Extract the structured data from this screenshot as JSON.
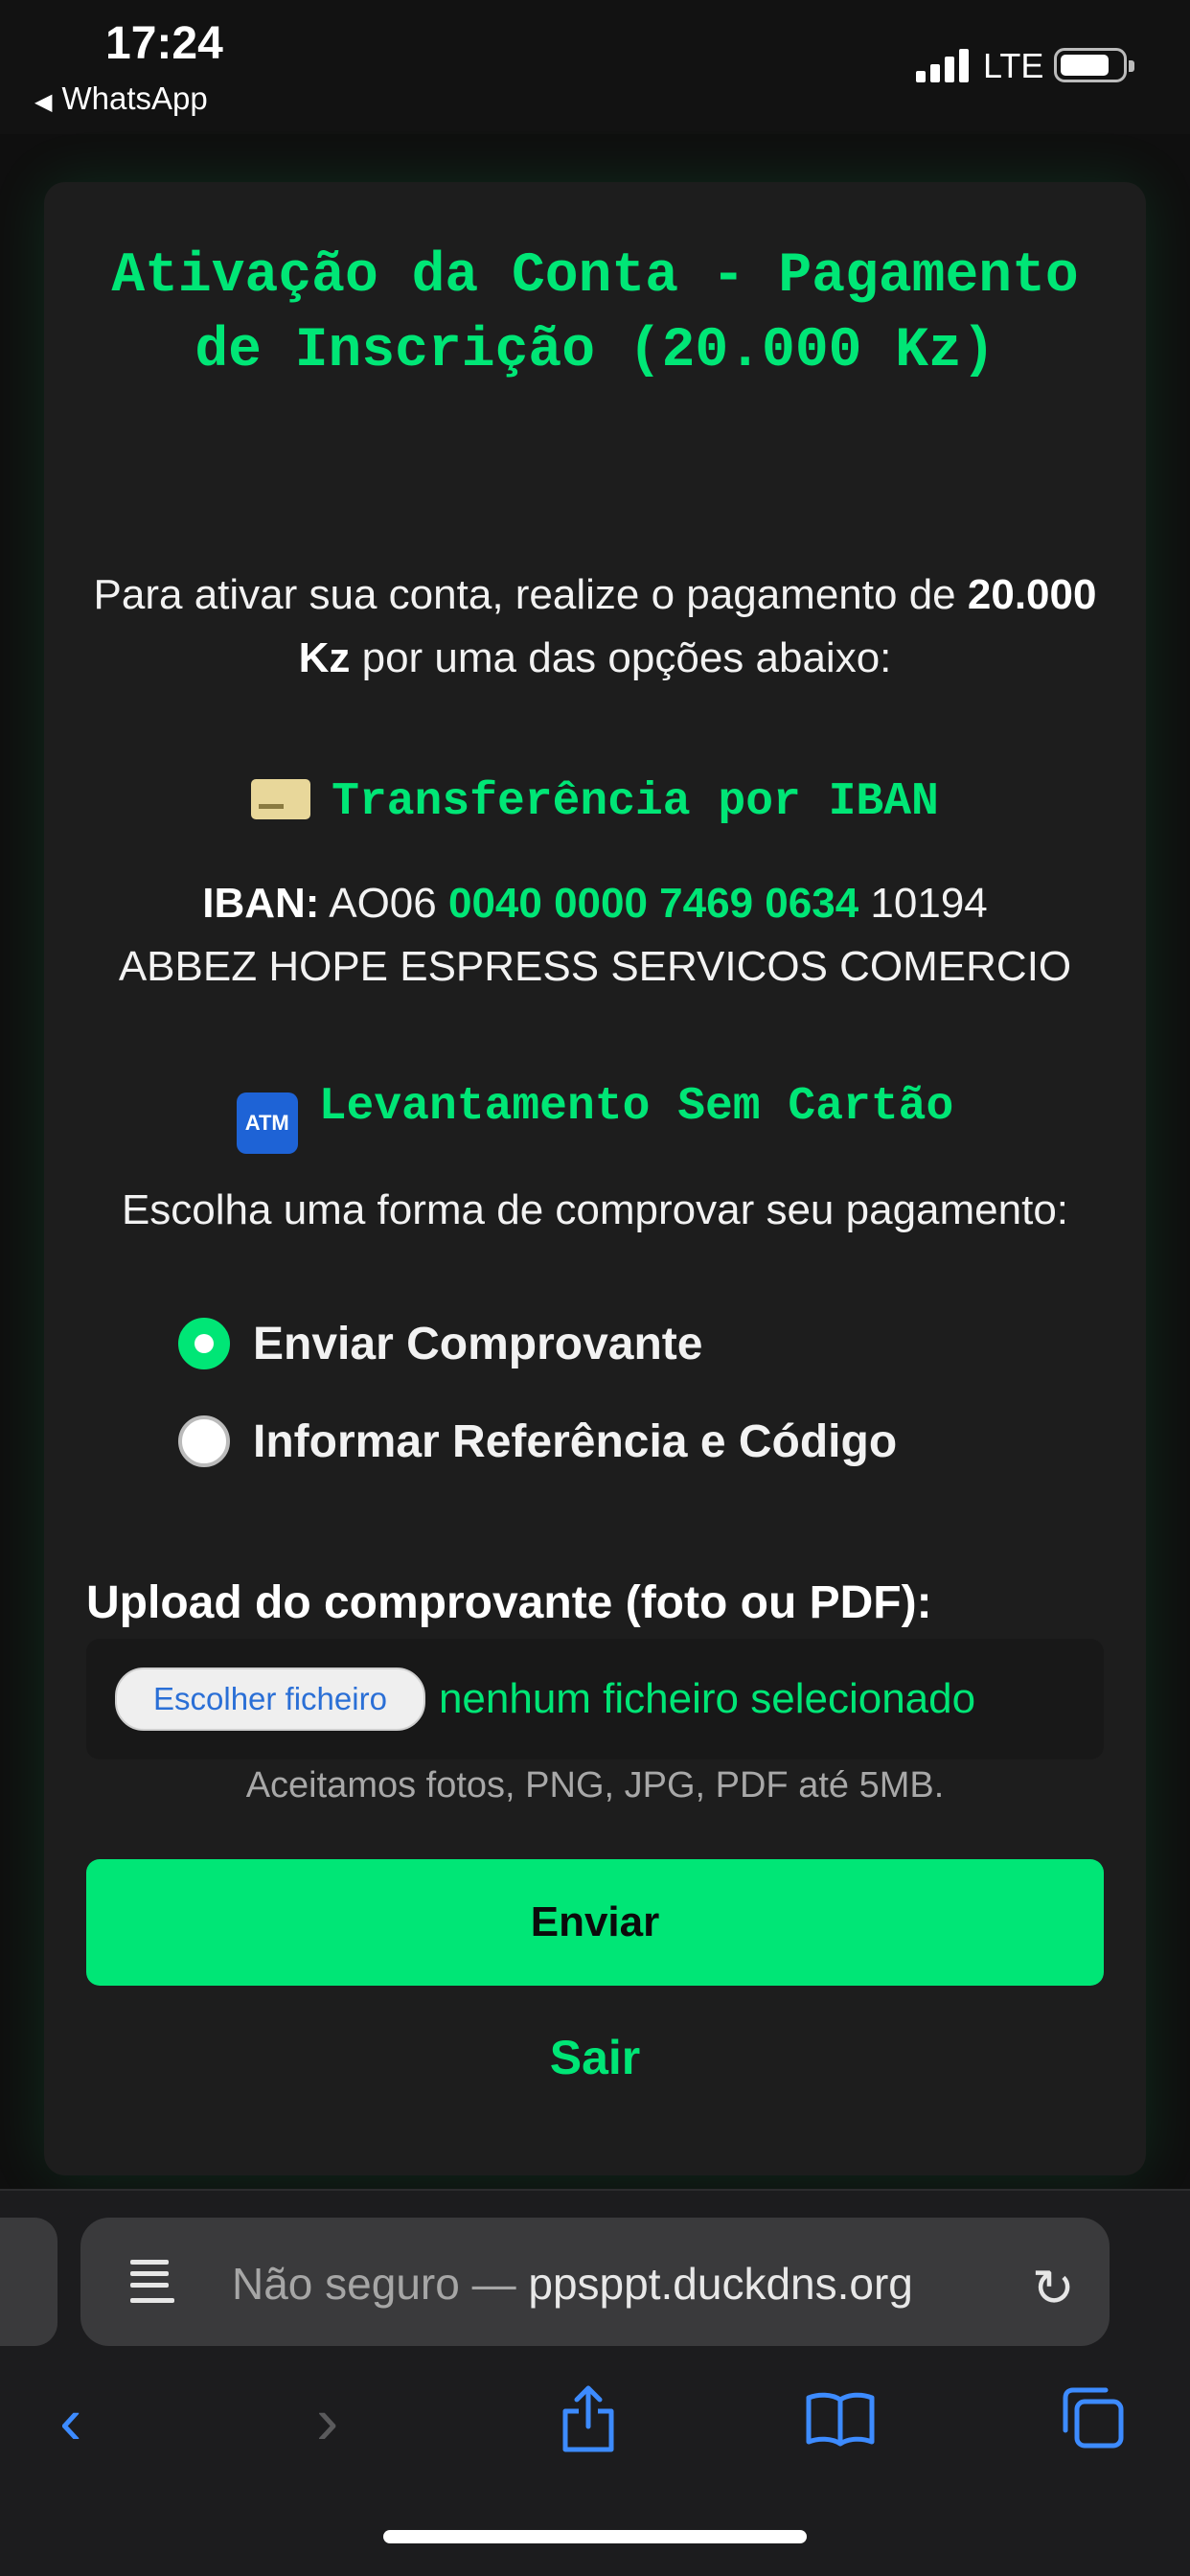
{
  "status": {
    "time": "17:24",
    "back_app": "WhatsApp",
    "network": "LTE"
  },
  "page": {
    "title": "Ativação da Conta - Pagamento de Inscrição (20.000 Kz)",
    "intro_pre": "Para ativar sua conta, realize o pagamento de ",
    "intro_amount": "20.000 Kz",
    "intro_post": " por uma das opções abaixo:",
    "iban_section": "Transferência por IBAN",
    "iban_label": "IBAN:",
    "iban_part1": " AO06 ",
    "iban_part2": "0040 0000 7469 0634",
    "iban_part3": " 10194",
    "iban_holder": "ABBEZ HOPE ESPRESS SERVICOS COMERCIO",
    "atm_section": "Levantamento Sem Cartão",
    "atm_icon_text": "ATM",
    "choose_text": "Escolha uma forma de comprovar seu pagamento:",
    "options": [
      {
        "label": "Enviar Comprovante",
        "selected": true
      },
      {
        "label": "Informar Referência e Código",
        "selected": false
      }
    ],
    "upload_label": "Upload do comprovante (foto ou PDF):",
    "file_button": "Escolher ficheiro",
    "file_status": "nenhum ficheiro selecionado",
    "hint": "Aceitamos fotos, PNG, JPG, PDF até 5MB.",
    "submit": "Enviar",
    "exit": "Sair"
  },
  "browser": {
    "security": "Não seguro — ",
    "domain": "ppsppt.duckdns.org"
  },
  "colors": {
    "accent": "#00e676",
    "background": "#0f0f0f",
    "card": "#1d1d1d",
    "link_blue": "#3d8bff"
  },
  "icons": [
    "credit-card-icon",
    "atm-icon",
    "reader-icon",
    "reload-icon",
    "back-icon",
    "forward-icon",
    "share-icon",
    "bookmarks-icon",
    "tabs-icon"
  ]
}
